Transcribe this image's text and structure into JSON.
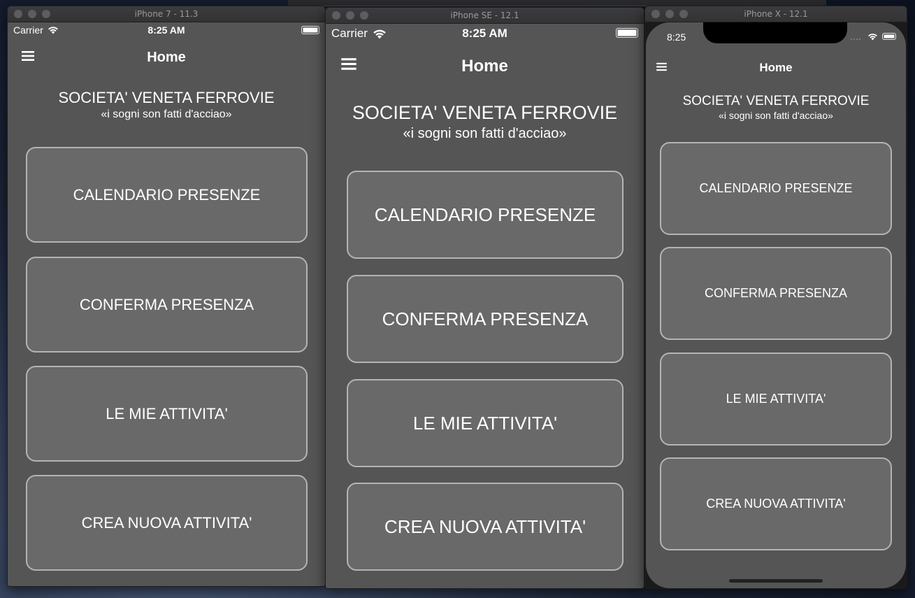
{
  "simulators": [
    {
      "title": "iPhone 7 - 11.3",
      "carrier": "Carrier",
      "time": "8:25 AM",
      "nav_title": "Home",
      "company": "SOCIETA' VENETA FERROVIE",
      "motto": "«i sogni son fatti d'acciao»",
      "buttons": [
        "CALENDARIO PRESENZE",
        "CONFERMA PRESENZA",
        "LE MIE ATTIVITA'",
        "CREA NUOVA ATTIVITA'"
      ]
    },
    {
      "title": "iPhone SE - 12.1",
      "carrier": "Carrier",
      "time": "8:25 AM",
      "nav_title": "Home",
      "company": "SOCIETA' VENETA FERROVIE",
      "motto": "«i sogni son fatti d'acciao»",
      "buttons": [
        "CALENDARIO PRESENZE",
        "CONFERMA PRESENZA",
        "LE MIE ATTIVITA'",
        "CREA NUOVA ATTIVITA'"
      ]
    },
    {
      "title": "iPhone X - 12.1",
      "time": "8:25",
      "nav_title": "Home",
      "company": "SOCIETA' VENETA FERROVIE",
      "motto": "«i sogni son fatti d'acciao»",
      "buttons": [
        "CALENDARIO PRESENZE",
        "CONFERMA PRESENZA",
        "LE MIE ATTIVITA'",
        "CREA NUOVA ATTIVITA'"
      ]
    }
  ],
  "colors": {
    "screen_bg": "#555555",
    "button_bg": "#696969",
    "button_border": "#b4b4b4",
    "text": "#ffffff"
  },
  "icons": [
    "menu-icon",
    "wifi-icon",
    "battery-icon",
    "signal-icon"
  ]
}
